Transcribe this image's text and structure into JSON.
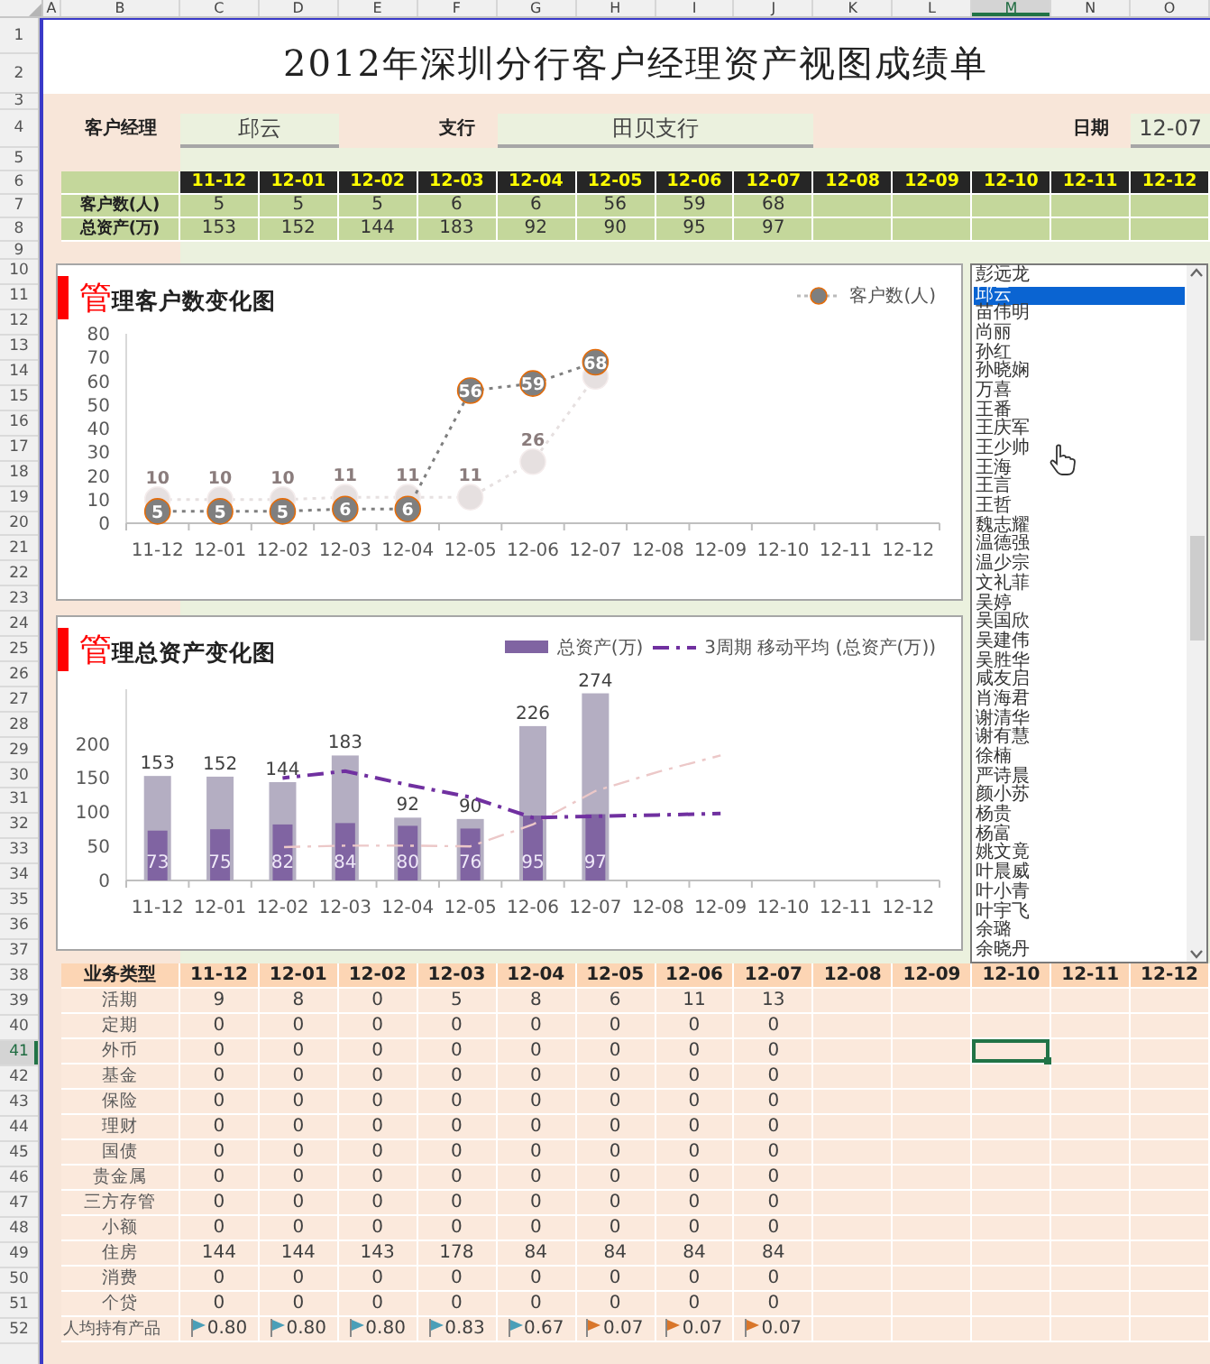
{
  "column_headers": [
    {
      "label": "A",
      "selected": false
    },
    {
      "label": "B",
      "selected": false
    },
    {
      "label": "C",
      "selected": false
    },
    {
      "label": "D",
      "selected": false
    },
    {
      "label": "E",
      "selected": false
    },
    {
      "label": "F",
      "selected": false
    },
    {
      "label": "G",
      "selected": false
    },
    {
      "label": "H",
      "selected": false
    },
    {
      "label": "I",
      "selected": false
    },
    {
      "label": "J",
      "selected": false
    },
    {
      "label": "K",
      "selected": false
    },
    {
      "label": "L",
      "selected": false
    },
    {
      "label": "M",
      "selected": true
    },
    {
      "label": "N",
      "selected": false
    },
    {
      "label": "O",
      "selected": false
    }
  ],
  "row_numbers": [
    {
      "label": "1",
      "selected": false
    },
    {
      "label": "2",
      "selected": false
    },
    {
      "label": "3",
      "selected": false
    },
    {
      "label": "4",
      "selected": false
    },
    {
      "label": "5",
      "selected": false
    },
    {
      "label": "6",
      "selected": false
    },
    {
      "label": "7",
      "selected": false
    },
    {
      "label": "8",
      "selected": false
    },
    {
      "label": "9",
      "selected": false
    },
    {
      "label": "10",
      "selected": false
    },
    {
      "label": "11",
      "selected": false
    },
    {
      "label": "12",
      "selected": false
    },
    {
      "label": "13",
      "selected": false
    },
    {
      "label": "14",
      "selected": false
    },
    {
      "label": "15",
      "selected": false
    },
    {
      "label": "16",
      "selected": false
    },
    {
      "label": "17",
      "selected": false
    },
    {
      "label": "18",
      "selected": false
    },
    {
      "label": "19",
      "selected": false
    },
    {
      "label": "20",
      "selected": false
    },
    {
      "label": "21",
      "selected": false
    },
    {
      "label": "22",
      "selected": false
    },
    {
      "label": "23",
      "selected": false
    },
    {
      "label": "24",
      "selected": false
    },
    {
      "label": "25",
      "selected": false
    },
    {
      "label": "26",
      "selected": false
    },
    {
      "label": "27",
      "selected": false
    },
    {
      "label": "28",
      "selected": false
    },
    {
      "label": "29",
      "selected": false
    },
    {
      "label": "30",
      "selected": false
    },
    {
      "label": "31",
      "selected": false
    },
    {
      "label": "32",
      "selected": false
    },
    {
      "label": "33",
      "selected": false
    },
    {
      "label": "34",
      "selected": false
    },
    {
      "label": "35",
      "selected": false
    },
    {
      "label": "36",
      "selected": false
    },
    {
      "label": "37",
      "selected": false
    },
    {
      "label": "38",
      "selected": false
    },
    {
      "label": "39",
      "selected": false
    },
    {
      "label": "40",
      "selected": false
    },
    {
      "label": "41",
      "selected": true
    },
    {
      "label": "42",
      "selected": false
    },
    {
      "label": "43",
      "selected": false
    },
    {
      "label": "44",
      "selected": false
    },
    {
      "label": "45",
      "selected": false
    },
    {
      "label": "46",
      "selected": false
    },
    {
      "label": "47",
      "selected": false
    },
    {
      "label": "48",
      "selected": false
    },
    {
      "label": "49",
      "selected": false
    },
    {
      "label": "50",
      "selected": false
    },
    {
      "label": "51",
      "selected": false
    },
    {
      "label": "52",
      "selected": false
    }
  ],
  "title": "2012年深圳分行客户经理资产视图成绩单",
  "info": {
    "manager_label": "客户经理",
    "manager": "邱云",
    "branch_label": "支行",
    "branch": "田贝支行",
    "date_label": "日期",
    "date": "12-07"
  },
  "summary": {
    "months": [
      "11-12",
      "12-01",
      "12-02",
      "12-03",
      "12-04",
      "12-05",
      "12-06",
      "12-07",
      "12-08",
      "12-09",
      "12-10",
      "12-11",
      "12-12"
    ],
    "rows": [
      {
        "label": "客户数(人)",
        "values": [
          "5",
          "5",
          "5",
          "6",
          "6",
          "56",
          "59",
          "68"
        ]
      },
      {
        "label": "总资产(万)",
        "values": [
          "153",
          "152",
          "144",
          "183",
          "92",
          "90",
          "95",
          "97"
        ]
      }
    ]
  },
  "customer_chart": {
    "title": "**管**理客户数变化图",
    "chart_data": {
      "type": "line",
      "categories": [
        "11-12",
        "12-01",
        "12-02",
        "12-03",
        "12-04",
        "12-05",
        "12-06",
        "12-07",
        "12-08",
        "12-09",
        "12-10",
        "12-11",
        "12-12"
      ],
      "ylim": [
        0,
        80
      ],
      "yticks": [
        0,
        10,
        20,
        30,
        40,
        50,
        60,
        70,
        80
      ],
      "data_labels": true,
      "series": [
        {
          "color": "#e6e0e0",
          "line_style": "dotted",
          "marker": "circle",
          "values": [
            10,
            10,
            10,
            11,
            11,
            11,
            26,
            62,
            null,
            null,
            null,
            null,
            null
          ],
          "value_labels": [
            "10",
            "10",
            "10",
            "11",
            "11",
            "11",
            "26",
            null,
            null,
            null,
            null,
            null,
            null
          ]
        },
        {
          "name": "客户数(人)",
          "color": "#7f7f7f",
          "line_style": "dotted",
          "marker": "circle",
          "values": [
            5,
            5,
            5,
            6,
            6,
            56,
            59,
            68,
            null,
            null,
            null,
            null,
            null
          ]
        }
      ]
    }
  },
  "asset_chart": {
    "title": "**管**理总资产变化图",
    "chart_data": {
      "type": "bar",
      "categories": [
        "11-12",
        "12-01",
        "12-02",
        "12-03",
        "12-04",
        "12-05",
        "12-06",
        "12-07",
        "12-08",
        "12-09",
        "12-10",
        "12-11",
        "12-12"
      ],
      "ylim": [
        0,
        280
      ],
      "yticks": [
        0,
        50,
        100,
        150,
        200
      ],
      "series": [
        {
          "name": "总资产(万)",
          "type": "bar",
          "color": "#8064a2",
          "values": [
            73,
            75,
            82,
            84,
            80,
            76,
            95,
            97,
            null,
            null,
            null,
            null,
            null
          ],
          "value_labels": [
            "73",
            "75",
            "82",
            "84",
            "80",
            "76",
            "95",
            "97",
            null,
            null,
            null,
            null,
            null
          ]
        },
        {
          "type": "bar",
          "color": "#b4aec2",
          "values": [
            153,
            152,
            144,
            183,
            92,
            90,
            226,
            274,
            null,
            null,
            null,
            null,
            null
          ],
          "value_labels": [
            "153",
            "152",
            "144",
            "183",
            "92",
            "90",
            "226",
            "274",
            null,
            null,
            null,
            null,
            null
          ]
        },
        {
          "type": "line",
          "color": "#ecc8c8",
          "line_style": "dashdot",
          "values": [
            null,
            null,
            49,
            51,
            51,
            50,
            82,
            131,
            159,
            183,
            null,
            null,
            null
          ]
        },
        {
          "name": "3周期 移动平均 (总资产(万))",
          "type": "line",
          "color": "#7030a0",
          "line_style": "dashdot",
          "values": [
            null,
            null,
            150,
            160,
            140,
            122,
            92,
            94,
            96,
            98,
            null,
            null,
            null
          ]
        }
      ],
      "stacked": false
    }
  },
  "manager_list": {
    "items": [
      {
        "name": "彭远龙",
        "selected": false
      },
      {
        "name": "邱云",
        "selected": true
      },
      {
        "name": "苗伟明",
        "selected": false
      },
      {
        "name": "尚丽",
        "selected": false
      },
      {
        "name": "孙红",
        "selected": false
      },
      {
        "name": "孙晓娴",
        "selected": false
      },
      {
        "name": "万喜",
        "selected": false
      },
      {
        "name": "王番",
        "selected": false
      },
      {
        "name": "王庆军",
        "selected": false
      },
      {
        "name": "王少帅",
        "selected": false
      },
      {
        "name": "王海",
        "selected": false
      },
      {
        "name": "王言",
        "selected": false
      },
      {
        "name": "王哲",
        "selected": false
      },
      {
        "name": "魏志耀",
        "selected": false
      },
      {
        "name": "温德强",
        "selected": false
      },
      {
        "name": "温少宗",
        "selected": false
      },
      {
        "name": "文礼菲",
        "selected": false
      },
      {
        "name": "吴婷",
        "selected": false
      },
      {
        "name": "吴国欣",
        "selected": false
      },
      {
        "name": "吴建伟",
        "selected": false
      },
      {
        "name": "吴胜华",
        "selected": false
      },
      {
        "name": "咸友启",
        "selected": false
      },
      {
        "name": "肖海君",
        "selected": false
      },
      {
        "name": "谢清华",
        "selected": false
      },
      {
        "name": "谢有慧",
        "selected": false
      },
      {
        "name": "徐楠",
        "selected": false
      },
      {
        "name": "严诗晨",
        "selected": false
      },
      {
        "name": "颜小苏",
        "selected": false
      },
      {
        "name": "杨贵",
        "selected": false
      },
      {
        "name": "杨富",
        "selected": false
      },
      {
        "name": "姚文竟",
        "selected": false
      },
      {
        "name": "叶晨威",
        "selected": false
      },
      {
        "name": "叶小青",
        "selected": false
      },
      {
        "name": "叶宇飞",
        "selected": false
      },
      {
        "name": "余璐",
        "selected": false
      },
      {
        "name": "余晓丹",
        "selected": false
      }
    ]
  },
  "business_table": {
    "header": "业务类型",
    "months": [
      "11-12",
      "12-01",
      "12-02",
      "12-03",
      "12-04",
      "12-05",
      "12-06",
      "12-07",
      "12-08",
      "12-09",
      "12-10",
      "12-11",
      "12-12"
    ],
    "rows": [
      {
        "type": "活期",
        "values": [
          "9",
          "8",
          "0",
          "5",
          "8",
          "6",
          "11",
          "13"
        ]
      },
      {
        "type": "定期",
        "values": [
          "0",
          "0",
          "0",
          "0",
          "0",
          "0",
          "0",
          "0"
        ]
      },
      {
        "type": "外币",
        "values": [
          "0",
          "0",
          "0",
          "0",
          "0",
          "0",
          "0",
          "0"
        ]
      },
      {
        "type": "基金",
        "values": [
          "0",
          "0",
          "0",
          "0",
          "0",
          "0",
          "0",
          "0"
        ]
      },
      {
        "type": "保险",
        "values": [
          "0",
          "0",
          "0",
          "0",
          "0",
          "0",
          "0",
          "0"
        ]
      },
      {
        "type": "理财",
        "values": [
          "0",
          "0",
          "0",
          "0",
          "0",
          "0",
          "0",
          "0"
        ]
      },
      {
        "type": "国债",
        "values": [
          "0",
          "0",
          "0",
          "0",
          "0",
          "0",
          "0",
          "0"
        ]
      },
      {
        "type": "贵金属",
        "values": [
          "0",
          "0",
          "0",
          "0",
          "0",
          "0",
          "0",
          "0"
        ]
      },
      {
        "type": "三方存管",
        "values": [
          "0",
          "0",
          "0",
          "0",
          "0",
          "0",
          "0",
          "0"
        ]
      },
      {
        "type": "小额",
        "values": [
          "0",
          "0",
          "0",
          "0",
          "0",
          "0",
          "0",
          "0"
        ]
      },
      {
        "type": "住房",
        "values": [
          "144",
          "144",
          "143",
          "178",
          "84",
          "84",
          "84",
          "84"
        ]
      },
      {
        "type": "消费",
        "values": [
          "0",
          "0",
          "0",
          "0",
          "0",
          "0",
          "0",
          "0"
        ]
      },
      {
        "type": "个贷",
        "values": [
          "0",
          "0",
          "0",
          "0",
          "0",
          "0",
          "0",
          "0"
        ]
      }
    ],
    "average": {
      "label": "人均持有产品",
      "values": [
        {
          "text": "0.80",
          "color": "#4a9fb8"
        },
        {
          "text": "0.80",
          "color": "#4a9fb8"
        },
        {
          "text": "0.80",
          "color": "#4a9fb8"
        },
        {
          "text": "0.83",
          "color": "#4a9fb8"
        },
        {
          "text": "0.67",
          "color": "#4a9fb8"
        },
        {
          "text": "0.07",
          "color": "#d9762a"
        },
        {
          "text": "0.07",
          "color": "#d9762a"
        },
        {
          "text": "0.07",
          "color": "#d9762a"
        }
      ]
    }
  }
}
